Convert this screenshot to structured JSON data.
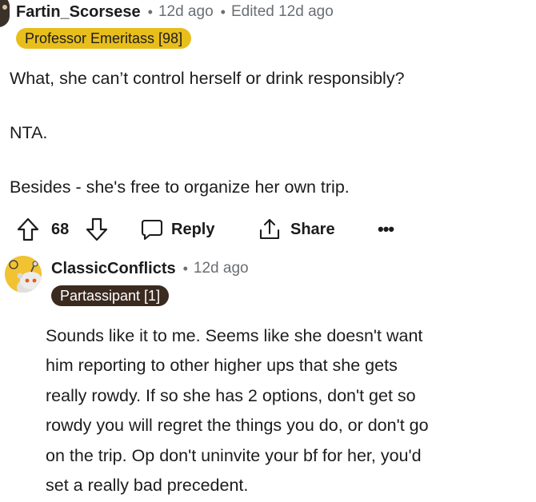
{
  "comment_1": {
    "author": "Fartin_Scorsese",
    "separator_1": "•",
    "time": "12d ago",
    "separator_2": "•",
    "edited": "Edited 12d ago",
    "flair": "Professor Emeritass [98]",
    "body": [
      "What, she can’t control herself or drink responsibly?",
      "NTA.",
      "Besides - she's free to organize her own trip."
    ],
    "actions": {
      "upvote_icon": "upvote-arrow-icon",
      "score": "68",
      "downvote_icon": "downvote-arrow-icon",
      "reply_icon": "comment-bubble-icon",
      "reply_label": "Reply",
      "share_icon": "share-upload-icon",
      "share_label": "Share",
      "more_label": "•••"
    }
  },
  "comment_2": {
    "author": "ClassicConflicts",
    "separator": "•",
    "time": "12d ago",
    "flair": "Partassipant [1]",
    "body_lines": [
      "Sounds like it to me. Seems like she doesn't want",
      "him reporting to other higher ups that she gets",
      "really rowdy. If so she has 2 options, don't get so",
      "rowdy you will regret the things you do, or don't go",
      "on the trip. Op don't uninvite your bf for her, you'd",
      "set a really bad precedent."
    ]
  },
  "colors": {
    "gold_flair": "#e8be1c",
    "dark_flair": "#3b2a20",
    "avatar_yellow": "#f1c232",
    "meta_gray": "#6b6f73",
    "text": "#1c1c1c"
  }
}
